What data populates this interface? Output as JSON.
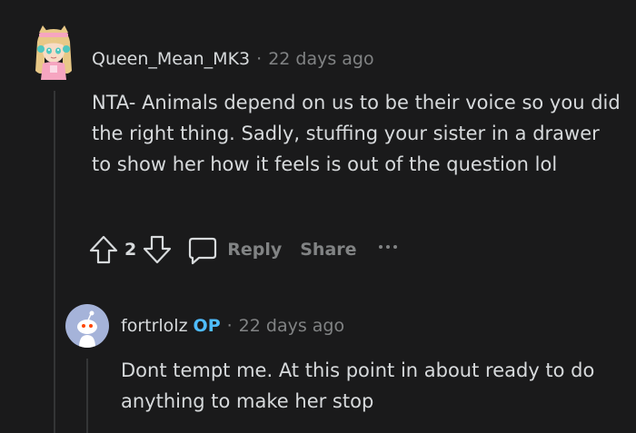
{
  "comments": [
    {
      "author": "Queen_Mean_MK3",
      "separator": "·",
      "time": "22 days ago",
      "body": "NTA- Animals depend on us to be their voice so you did the right thing. Sadly, stuffing your sister in a drawer to show her how it feels is out of the question lol",
      "vote_count": "2",
      "reply_label": "Reply",
      "share_label": "Share"
    },
    {
      "author": "fortrlolz",
      "op_tag": "OP",
      "separator": "·",
      "time": "22 days ago",
      "body": "Dont tempt me. At this point in about ready to do anything to make her stop"
    }
  ],
  "colors": {
    "background": "#1a1a1b",
    "text": "#d7dadc",
    "muted": "#818384",
    "op_accent": "#4fbcff",
    "thread_line": "#343536",
    "default_avatar_bg": "#a5b3d9"
  },
  "icons": [
    "upvote-icon",
    "downvote-icon",
    "comment-icon",
    "more-options-icon",
    "snoo-avatar-icon"
  ]
}
